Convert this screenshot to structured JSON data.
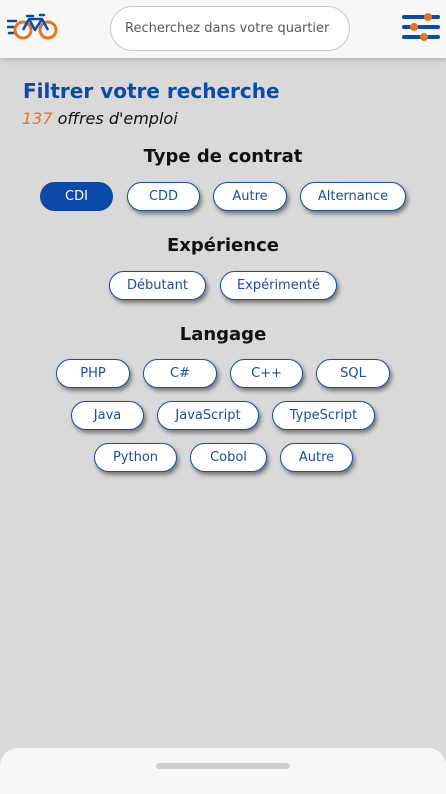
{
  "header": {
    "search_placeholder": "Recherchez dans votre quartier",
    "logo_icon": "bike-icon",
    "menu_icon": "filter-sliders-icon"
  },
  "filters": {
    "title": "Filtrer votre recherche",
    "count_value": "137",
    "count_label": " offres d'emploi"
  },
  "contract": {
    "title": "Type de contrat",
    "options": [
      "CDI",
      "CDD",
      "Autre",
      "Alternance"
    ],
    "selected": "CDI"
  },
  "experience": {
    "title": "Expérience",
    "options": [
      "Débutant",
      "Expérimenté"
    ]
  },
  "language": {
    "title": "Langage",
    "options": [
      "PHP",
      "C#",
      "C++",
      "SQL",
      "Java",
      "JavaScript",
      "TypeScript",
      "Python",
      "Cobol",
      "Autre"
    ]
  },
  "colors": {
    "primary_blue": "#0b4aa8",
    "accent_orange": "#e8741e",
    "background": "#d9d9d9"
  }
}
